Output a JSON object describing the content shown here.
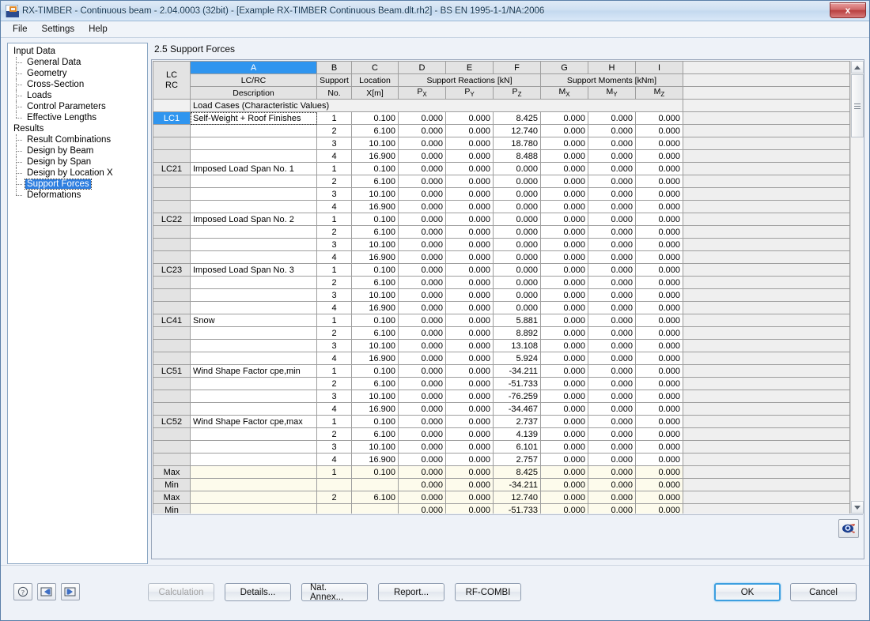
{
  "window": {
    "title": "RX-TIMBER - Continuous beam - 2.04.0003 (32bit) - [Example RX-TIMBER Continuous Beam.dlt.rh2] - BS EN 1995-1-1/NA:2006",
    "close_label": "x"
  },
  "menu": {
    "items": [
      "File",
      "Settings",
      "Help"
    ]
  },
  "sidebar": {
    "groups": [
      {
        "label": "Input Data",
        "items": [
          "General Data",
          "Geometry",
          "Cross-Section",
          "Loads",
          "Control Parameters",
          "Effective Lengths"
        ]
      },
      {
        "label": "Results",
        "items": [
          "Result Combinations",
          "Design by Beam",
          "Design by Span",
          "Design by Location X",
          "Support Forces",
          "Deformations"
        ]
      }
    ],
    "selected": "Support Forces"
  },
  "section": {
    "title": "2.5 Support Forces"
  },
  "table": {
    "column_letters": [
      "A",
      "B",
      "C",
      "D",
      "E",
      "F",
      "G",
      "H",
      "I"
    ],
    "selected_letter": "A",
    "corner_label_line1": "LC",
    "corner_label_line2": "RC",
    "group_headers": {
      "a_line1": "LC/RC",
      "a_line2": "Description",
      "b_line1": "Support",
      "b_line2": "No.",
      "c_line1": "Location",
      "c_line2": "X[m]",
      "reactions": "Support Reactions [kN]",
      "reaction_subs": [
        "P",
        "P",
        "P"
      ],
      "reaction_sub_idx": [
        "X",
        "Y",
        "Z"
      ],
      "moments": "Support Moments [kNm]",
      "moment_subs": [
        "M",
        "M",
        "M"
      ],
      "moment_sub_idx": [
        "X",
        "Y",
        "Z"
      ]
    },
    "group_caption": "Load Cases (Characteristic Values)",
    "rows": [
      {
        "lc": "LC1",
        "selected": true,
        "desc": "Self-Weight + Roof Finishes",
        "desc_active": true,
        "no": "1",
        "x": "0.100",
        "px": "0.000",
        "py": "0.000",
        "pz": "8.425",
        "mx": "0.000",
        "my": "0.000",
        "mz": "0.000"
      },
      {
        "lc": "",
        "desc": "",
        "no": "2",
        "x": "6.100",
        "px": "0.000",
        "py": "0.000",
        "pz": "12.740",
        "mx": "0.000",
        "my": "0.000",
        "mz": "0.000"
      },
      {
        "lc": "",
        "desc": "",
        "no": "3",
        "x": "10.100",
        "px": "0.000",
        "py": "0.000",
        "pz": "18.780",
        "mx": "0.000",
        "my": "0.000",
        "mz": "0.000"
      },
      {
        "lc": "",
        "desc": "",
        "no": "4",
        "x": "16.900",
        "px": "0.000",
        "py": "0.000",
        "pz": "8.488",
        "mx": "0.000",
        "my": "0.000",
        "mz": "0.000"
      },
      {
        "lc": "LC21",
        "desc": "Imposed Load Span No. 1",
        "no": "1",
        "x": "0.100",
        "px": "0.000",
        "py": "0.000",
        "pz": "0.000",
        "mx": "0.000",
        "my": "0.000",
        "mz": "0.000"
      },
      {
        "lc": "",
        "desc": "",
        "no": "2",
        "x": "6.100",
        "px": "0.000",
        "py": "0.000",
        "pz": "0.000",
        "mx": "0.000",
        "my": "0.000",
        "mz": "0.000"
      },
      {
        "lc": "",
        "desc": "",
        "no": "3",
        "x": "10.100",
        "px": "0.000",
        "py": "0.000",
        "pz": "0.000",
        "mx": "0.000",
        "my": "0.000",
        "mz": "0.000"
      },
      {
        "lc": "",
        "desc": "",
        "no": "4",
        "x": "16.900",
        "px": "0.000",
        "py": "0.000",
        "pz": "0.000",
        "mx": "0.000",
        "my": "0.000",
        "mz": "0.000"
      },
      {
        "lc": "LC22",
        "desc": "Imposed Load Span No. 2",
        "no": "1",
        "x": "0.100",
        "px": "0.000",
        "py": "0.000",
        "pz": "0.000",
        "mx": "0.000",
        "my": "0.000",
        "mz": "0.000"
      },
      {
        "lc": "",
        "desc": "",
        "no": "2",
        "x": "6.100",
        "px": "0.000",
        "py": "0.000",
        "pz": "0.000",
        "mx": "0.000",
        "my": "0.000",
        "mz": "0.000"
      },
      {
        "lc": "",
        "desc": "",
        "no": "3",
        "x": "10.100",
        "px": "0.000",
        "py": "0.000",
        "pz": "0.000",
        "mx": "0.000",
        "my": "0.000",
        "mz": "0.000"
      },
      {
        "lc": "",
        "desc": "",
        "no": "4",
        "x": "16.900",
        "px": "0.000",
        "py": "0.000",
        "pz": "0.000",
        "mx": "0.000",
        "my": "0.000",
        "mz": "0.000"
      },
      {
        "lc": "LC23",
        "desc": "Imposed Load Span No. 3",
        "no": "1",
        "x": "0.100",
        "px": "0.000",
        "py": "0.000",
        "pz": "0.000",
        "mx": "0.000",
        "my": "0.000",
        "mz": "0.000"
      },
      {
        "lc": "",
        "desc": "",
        "no": "2",
        "x": "6.100",
        "px": "0.000",
        "py": "0.000",
        "pz": "0.000",
        "mx": "0.000",
        "my": "0.000",
        "mz": "0.000"
      },
      {
        "lc": "",
        "desc": "",
        "no": "3",
        "x": "10.100",
        "px": "0.000",
        "py": "0.000",
        "pz": "0.000",
        "mx": "0.000",
        "my": "0.000",
        "mz": "0.000"
      },
      {
        "lc": "",
        "desc": "",
        "no": "4",
        "x": "16.900",
        "px": "0.000",
        "py": "0.000",
        "pz": "0.000",
        "mx": "0.000",
        "my": "0.000",
        "mz": "0.000"
      },
      {
        "lc": "LC41",
        "desc": "Snow",
        "no": "1",
        "x": "0.100",
        "px": "0.000",
        "py": "0.000",
        "pz": "5.881",
        "mx": "0.000",
        "my": "0.000",
        "mz": "0.000"
      },
      {
        "lc": "",
        "desc": "",
        "no": "2",
        "x": "6.100",
        "px": "0.000",
        "py": "0.000",
        "pz": "8.892",
        "mx": "0.000",
        "my": "0.000",
        "mz": "0.000"
      },
      {
        "lc": "",
        "desc": "",
        "no": "3",
        "x": "10.100",
        "px": "0.000",
        "py": "0.000",
        "pz": "13.108",
        "mx": "0.000",
        "my": "0.000",
        "mz": "0.000"
      },
      {
        "lc": "",
        "desc": "",
        "no": "4",
        "x": "16.900",
        "px": "0.000",
        "py": "0.000",
        "pz": "5.924",
        "mx": "0.000",
        "my": "0.000",
        "mz": "0.000"
      },
      {
        "lc": "LC51",
        "desc": "Wind Shape Factor cpe,min",
        "no": "1",
        "x": "0.100",
        "px": "0.000",
        "py": "0.000",
        "pz": "-34.211",
        "mx": "0.000",
        "my": "0.000",
        "mz": "0.000"
      },
      {
        "lc": "",
        "desc": "",
        "no": "2",
        "x": "6.100",
        "px": "0.000",
        "py": "0.000",
        "pz": "-51.733",
        "mx": "0.000",
        "my": "0.000",
        "mz": "0.000"
      },
      {
        "lc": "",
        "desc": "",
        "no": "3",
        "x": "10.100",
        "px": "0.000",
        "py": "0.000",
        "pz": "-76.259",
        "mx": "0.000",
        "my": "0.000",
        "mz": "0.000"
      },
      {
        "lc": "",
        "desc": "",
        "no": "4",
        "x": "16.900",
        "px": "0.000",
        "py": "0.000",
        "pz": "-34.467",
        "mx": "0.000",
        "my": "0.000",
        "mz": "0.000"
      },
      {
        "lc": "LC52",
        "desc": "Wind Shape Factor cpe,max",
        "no": "1",
        "x": "0.100",
        "px": "0.000",
        "py": "0.000",
        "pz": "2.737",
        "mx": "0.000",
        "my": "0.000",
        "mz": "0.000"
      },
      {
        "lc": "",
        "desc": "",
        "no": "2",
        "x": "6.100",
        "px": "0.000",
        "py": "0.000",
        "pz": "4.139",
        "mx": "0.000",
        "my": "0.000",
        "mz": "0.000"
      },
      {
        "lc": "",
        "desc": "",
        "no": "3",
        "x": "10.100",
        "px": "0.000",
        "py": "0.000",
        "pz": "6.101",
        "mx": "0.000",
        "my": "0.000",
        "mz": "0.000"
      },
      {
        "lc": "",
        "desc": "",
        "no": "4",
        "x": "16.900",
        "px": "0.000",
        "py": "0.000",
        "pz": "2.757",
        "mx": "0.000",
        "my": "0.000",
        "mz": "0.000"
      },
      {
        "lc": "Max",
        "minmax": true,
        "desc": "",
        "no": "1",
        "x": "0.100",
        "px": "0.000",
        "py": "0.000",
        "pz": "8.425",
        "mx": "0.000",
        "my": "0.000",
        "mz": "0.000"
      },
      {
        "lc": "Min",
        "minmax": true,
        "desc": "",
        "no": "",
        "x": "",
        "px": "0.000",
        "py": "0.000",
        "pz": "-34.211",
        "mx": "0.000",
        "my": "0.000",
        "mz": "0.000"
      },
      {
        "lc": "Max",
        "minmax": true,
        "desc": "",
        "no": "2",
        "x": "6.100",
        "px": "0.000",
        "py": "0.000",
        "pz": "12.740",
        "mx": "0.000",
        "my": "0.000",
        "mz": "0.000"
      },
      {
        "lc": "Min",
        "minmax": true,
        "desc": "",
        "no": "",
        "x": "",
        "px": "0.000",
        "py": "0.000",
        "pz": "-51.733",
        "mx": "0.000",
        "my": "0.000",
        "mz": "0.000"
      }
    ]
  },
  "footer": {
    "help_icon": "question-mark-icon",
    "prev_icon": "arrow-left-icon",
    "next_icon": "arrow-right-icon",
    "buttons": [
      "Calculation",
      "Details...",
      "Nat. Annex...",
      "Report...",
      "RF-COMBI"
    ],
    "calculation_disabled": true,
    "ok": "OK",
    "cancel": "Cancel"
  },
  "colors": {
    "selection_blue": "#2f95ef",
    "minmax_row": "#fdfbec",
    "header_gray": "#e3e3e3"
  }
}
